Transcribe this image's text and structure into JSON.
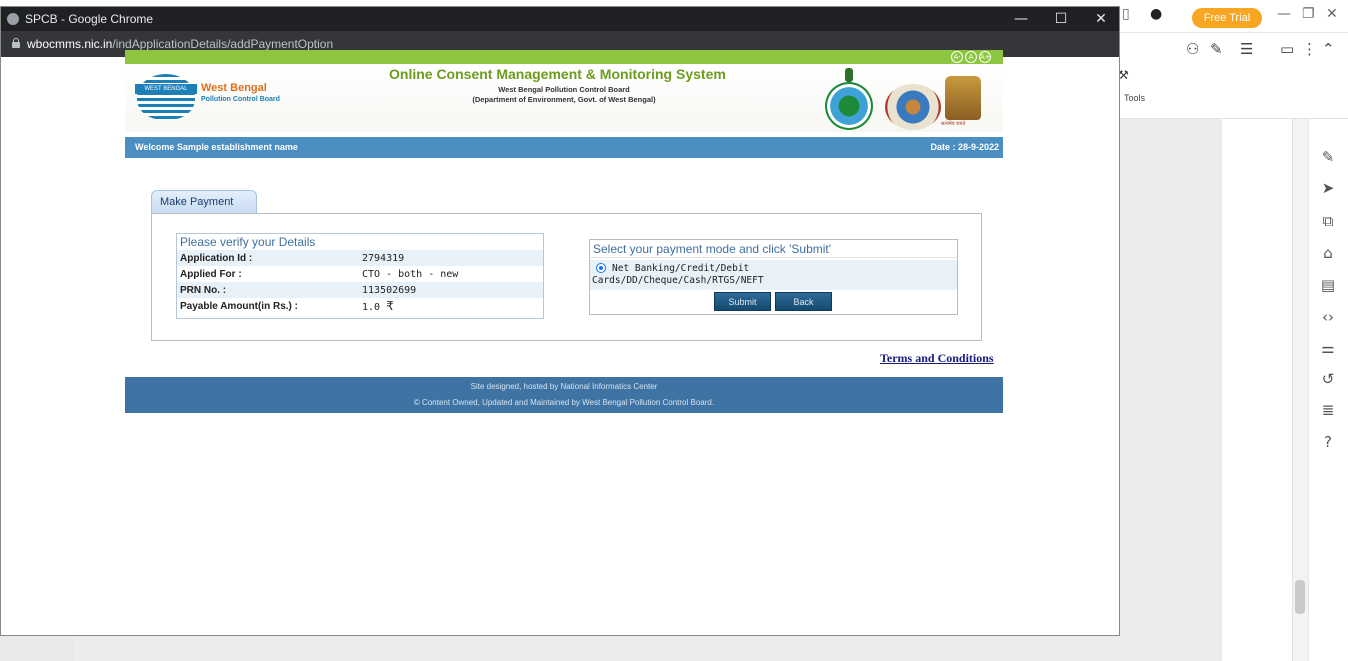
{
  "background_app": {
    "free_trial_label": "Free Trial",
    "tools_label": "Tools",
    "sidebar_icons": [
      "pen-icon",
      "cursor-icon",
      "crop-icon",
      "lock-icon",
      "stamp-icon",
      "code-icon",
      "sliders-icon",
      "history-icon",
      "layers-icon",
      "help-icon"
    ]
  },
  "browser": {
    "window_title": "SPCB - Google Chrome",
    "url_host": "wbocmms.nic.in",
    "url_path": "/indApplicationDetails/addPaymentOption",
    "minimize": "—",
    "maximize": "☐",
    "close": "✕"
  },
  "header": {
    "logo_banner": "WEST BENGAL",
    "logo_state": "West Bengal",
    "logo_board": "Pollution Control Board",
    "system_title": "Online Consent Management & Monitoring System",
    "sub_title_1": "West Bengal Pollution Control Board",
    "sub_title_2": "(Department of Environment, Govt. of West Bengal)",
    "emblem_text": "सत्यमेव जयते",
    "font_buttons": [
      "A-",
      "A",
      "A+"
    ]
  },
  "welcome": {
    "message": "Welcome Sample establishment name",
    "date": "Date : 28-9-2022"
  },
  "payment": {
    "tab_label": "Make Payment",
    "details_heading": "Please verify your Details",
    "rows": [
      {
        "label": "Application Id :",
        "value": "2794319"
      },
      {
        "label": "Applied For :",
        "value": "CTO - both - new"
      },
      {
        "label": "PRN No. :",
        "value": "113502699"
      },
      {
        "label": "Payable Amount(in Rs.) :",
        "value": "1.0",
        "currency": "₹"
      }
    ],
    "mode_heading": "Select your payment mode and click 'Submit'",
    "mode_option_line1": "Net Banking/Credit/Debit",
    "mode_option_line2": "Cards/DD/Cheque/Cash/RTGS/NEFT",
    "submit_label": "Submit",
    "back_label": "Back"
  },
  "terms_label": "Terms and Conditions",
  "footer": {
    "line1": "Site designed, hosted by National Informatics Center",
    "line2": "© Content Owned, Updated and Maintained by West Bengal Pollution Control Board."
  }
}
